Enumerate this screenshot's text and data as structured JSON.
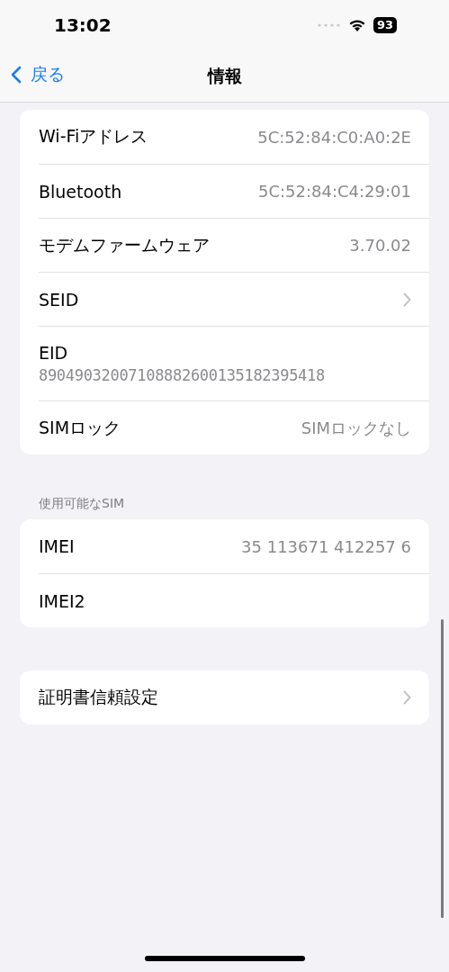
{
  "status_bar": {
    "time": "13:02",
    "battery": "93"
  },
  "nav": {
    "back": "戻る",
    "title": "情報"
  },
  "sections": [
    {
      "rows": [
        {
          "kind": "value",
          "label": "Wi-Fiアドレス",
          "value": "5C:52:84:C0:A0:2E"
        },
        {
          "kind": "value",
          "label": "Bluetooth",
          "value": "5C:52:84:C4:29:01"
        },
        {
          "kind": "value",
          "label": "モデムファームウェア",
          "value": "3.70.02"
        },
        {
          "kind": "chevron",
          "label": "SEID"
        },
        {
          "kind": "subtitle",
          "label": "EID",
          "value": "89049032007108882600135182395418"
        },
        {
          "kind": "value",
          "label": "SIMロック",
          "value": "SIMロックなし"
        }
      ]
    },
    {
      "header": "使用可能なSIM",
      "rows": [
        {
          "kind": "value",
          "label": "IMEI",
          "value": "35 113671 412257 6"
        },
        {
          "kind": "plain",
          "label": "IMEI2"
        }
      ]
    },
    {
      "rows": [
        {
          "kind": "chevron",
          "label": "証明書信頼設定"
        }
      ]
    }
  ]
}
